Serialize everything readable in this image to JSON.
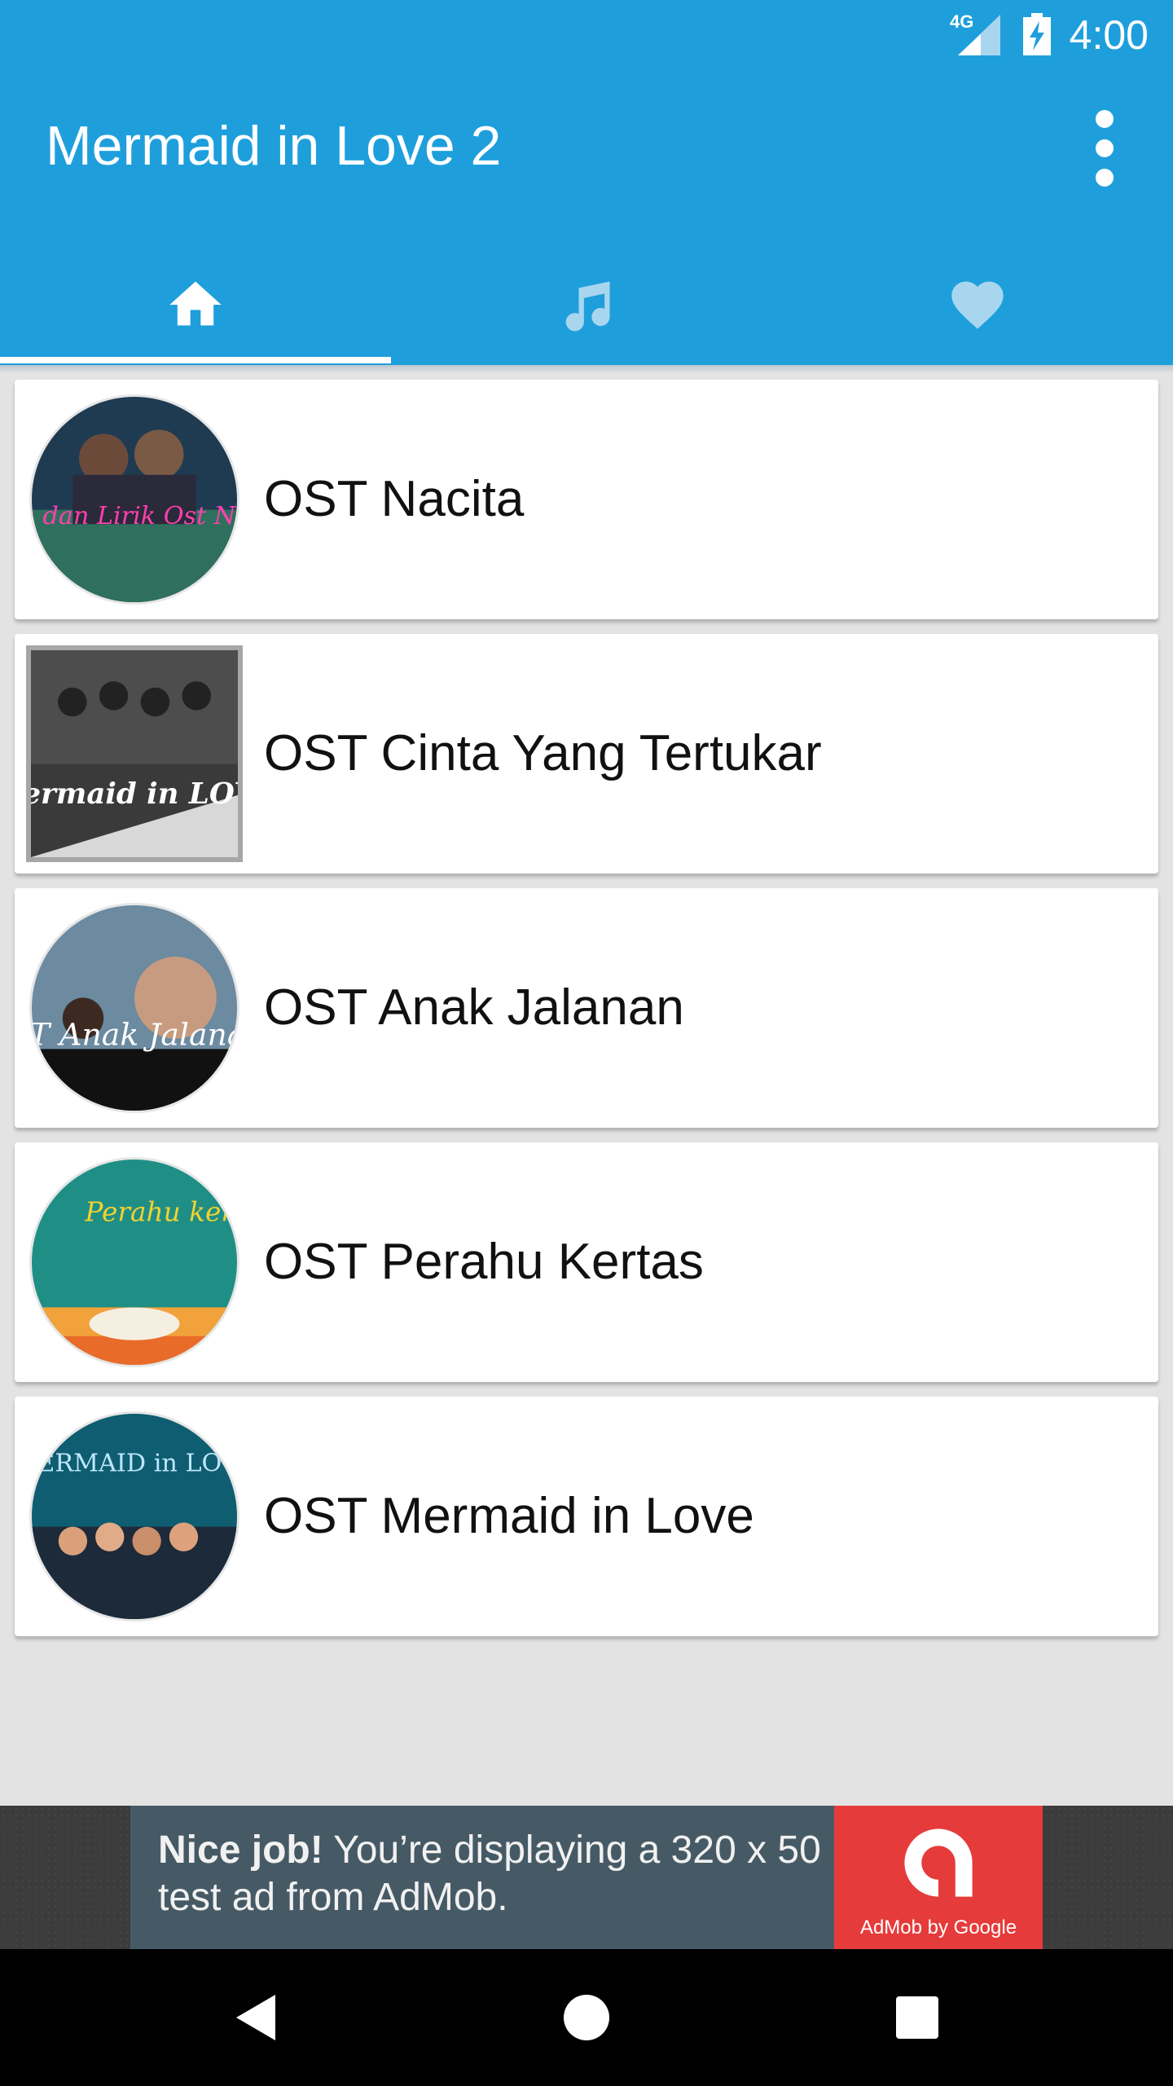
{
  "status_bar": {
    "time": "4:00",
    "network": "4G"
  },
  "app_bar": {
    "title": "Mermaid in Love 2"
  },
  "tabs": [
    {
      "icon": "home-icon",
      "selected": true
    },
    {
      "icon": "music-note-icon",
      "selected": false
    },
    {
      "icon": "heart-icon",
      "selected": false
    }
  ],
  "list": {
    "items": [
      {
        "label": "OST Nacita",
        "thumbnail_text": "Lagu dan Lirik Ost Nacita"
      },
      {
        "label": "OST Cinta Yang Tertukar",
        "thumbnail_text": "Mermaid in LOVE"
      },
      {
        "label": "OST Anak Jalanan",
        "thumbnail_text": "OST Anak Jalanan"
      },
      {
        "label": "OST Perahu Kertas",
        "thumbnail_text": "Perahu kertas"
      },
      {
        "label": "OST Mermaid in Love",
        "thumbnail_text": "MERMAID in LOVE"
      }
    ]
  },
  "ad": {
    "headline": "Nice job!",
    "body": " You’re displaying a 320 x 50 test ad from AdMob.",
    "logo_text": "AdMob by Google"
  },
  "colors": {
    "primary": "#1e9fdc",
    "background": "#e3e3e3",
    "ad_red": "#e63b3b"
  }
}
